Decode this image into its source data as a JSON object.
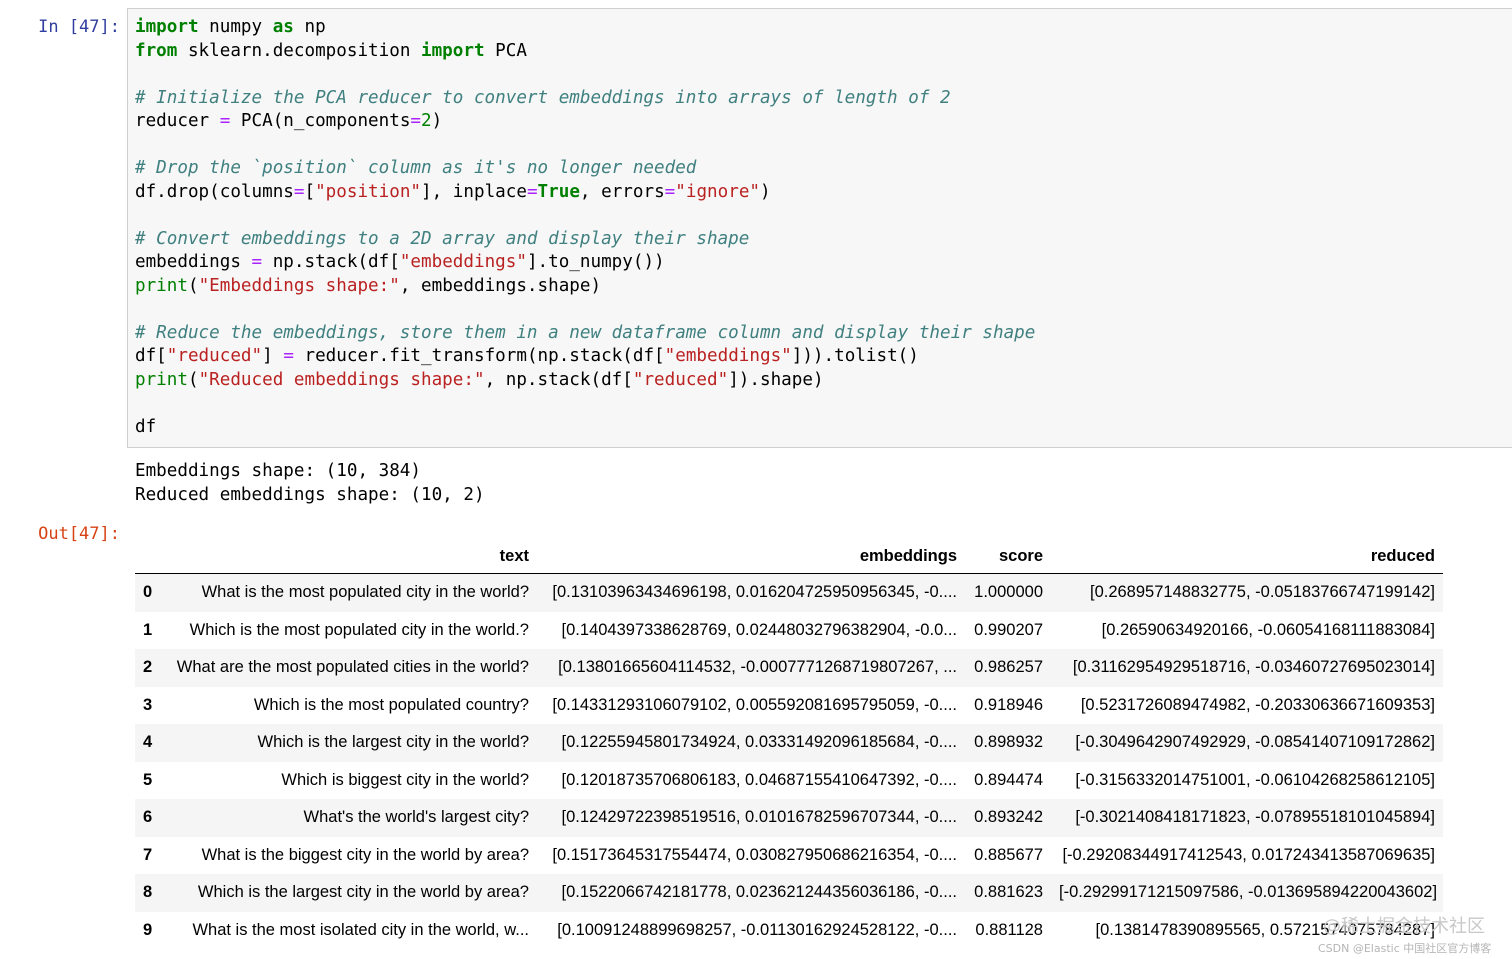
{
  "input_prompt": "In [47]:",
  "output_prompt": "Out[47]:",
  "code": {
    "l1": {
      "kw1": "import",
      "a": " numpy ",
      "kw2": "as",
      "b": " np"
    },
    "l2": {
      "kw1": "from",
      "a": " sklearn.decomposition ",
      "kw2": "import",
      "b": " PCA"
    },
    "c1": "# Initialize the PCA reducer to convert embeddings into arrays of length of 2",
    "l4": {
      "a": "reducer ",
      "op1": "=",
      "b": " PCA(n_components",
      "op2": "=",
      "num": "2",
      "c": ")"
    },
    "c2": "# Drop the `position` column as it's no longer needed",
    "l6": {
      "a": "df.drop(columns",
      "op1": "=",
      "b": "[",
      "s1": "\"position\"",
      "c": "], inplace",
      "op2": "=",
      "kw": "True",
      "d": ", errors",
      "op3": "=",
      "s2": "\"ignore\"",
      "e": ")"
    },
    "c3": "# Convert embeddings to a 2D array and display their shape",
    "l8": {
      "a": "embeddings ",
      "op1": "=",
      "b": " np.stack(df[",
      "s1": "\"embeddings\"",
      "c": "].to_numpy())"
    },
    "l9": {
      "kw": "print",
      "a": "(",
      "s1": "\"Embeddings shape:\"",
      "b": ", embeddings.shape)"
    },
    "c4": "# Reduce the embeddings, store them in a new dataframe column and display their shape",
    "l11": {
      "a": "df[",
      "s1": "\"reduced\"",
      "b": "] ",
      "op1": "=",
      "c": " reducer.fit_transform(np.stack(df[",
      "s2": "\"embeddings\"",
      "d": "])).tolist()"
    },
    "l12": {
      "kw": "print",
      "a": "(",
      "s1": "\"Reduced embeddings shape:\"",
      "b": ", np.stack(df[",
      "s2": "\"reduced\"",
      "c": "]).shape)"
    },
    "l14": "df"
  },
  "stdout": {
    "line1": "Embeddings shape: (10, 384)",
    "line2": "Reduced embeddings shape: (10, 2)"
  },
  "table": {
    "columns": [
      "",
      "text",
      "embeddings",
      "score",
      "reduced"
    ],
    "rows": [
      [
        "0",
        "What is the most populated city in the world?",
        "[0.13103963434696198, 0.016204725950956345, -0....",
        "1.000000",
        "[0.268957148832775, -0.05183766747199142]"
      ],
      [
        "1",
        "Which is the most populated city in the world.?",
        "[0.1404397338628769, 0.02448032796382904, -0.0...",
        "0.990207",
        "[0.26590634920166, -0.06054168111883084]"
      ],
      [
        "2",
        "What are the most populated cities in the world?",
        "[0.13801665604114532, -0.0007771268719807267, ...",
        "0.986257",
        "[0.31162954929518716, -0.03460727695023014]"
      ],
      [
        "3",
        "Which is the most populated country?",
        "[0.14331293106079102, 0.005592081695795059, -0....",
        "0.918946",
        "[0.5231726089474982, -0.20330636671609353]"
      ],
      [
        "4",
        "Which is the largest city in the world?",
        "[0.12255945801734924, 0.03331492096185684, -0....",
        "0.898932",
        "[-0.3049642907492929, -0.08541407109172862]"
      ],
      [
        "5",
        "Which is biggest city in the world?",
        "[0.12018735706806183, 0.04687155410647392, -0....",
        "0.894474",
        "[-0.3156332014751001, -0.06104268258612105]"
      ],
      [
        "6",
        "What's the world's largest city?",
        "[0.12429722398519516, 0.01016782596707344, -0....",
        "0.893242",
        "[-0.3021408418171823, -0.07895518101045894]"
      ],
      [
        "7",
        "What is the biggest city in the world by area?",
        "[0.15173645317554474, 0.030827950686216354, -0....",
        "0.885677",
        "[-0.29208344917412543, 0.017243413587069635]"
      ],
      [
        "8",
        "Which is the largest city in the world by area?",
        "[0.1522066742181778, 0.023621244356036186, -0....",
        "0.881623",
        "[-0.29299171215097586, -0.013695894220043602]"
      ],
      [
        "9",
        "What is the most isolated city in the world, w...",
        "[0.10091248899698257, -0.01130162924528122, -0....",
        "0.881128",
        "[0.1381478390895565, 0.5721574075784287]"
      ]
    ]
  },
  "watermark": {
    "main": "@稀土掘金技术社区",
    "sub": "CSDN @Elastic 中国社区官方博客"
  },
  "colors": {
    "in_prompt": "#303f9f",
    "out_prompt": "#d84315",
    "keyword": "#008000",
    "string": "#ba2121",
    "operator": "#aa22ff",
    "comment": "#408080",
    "cell_background": "#f7f7f7",
    "row_stripe": "#f5f5f5"
  }
}
